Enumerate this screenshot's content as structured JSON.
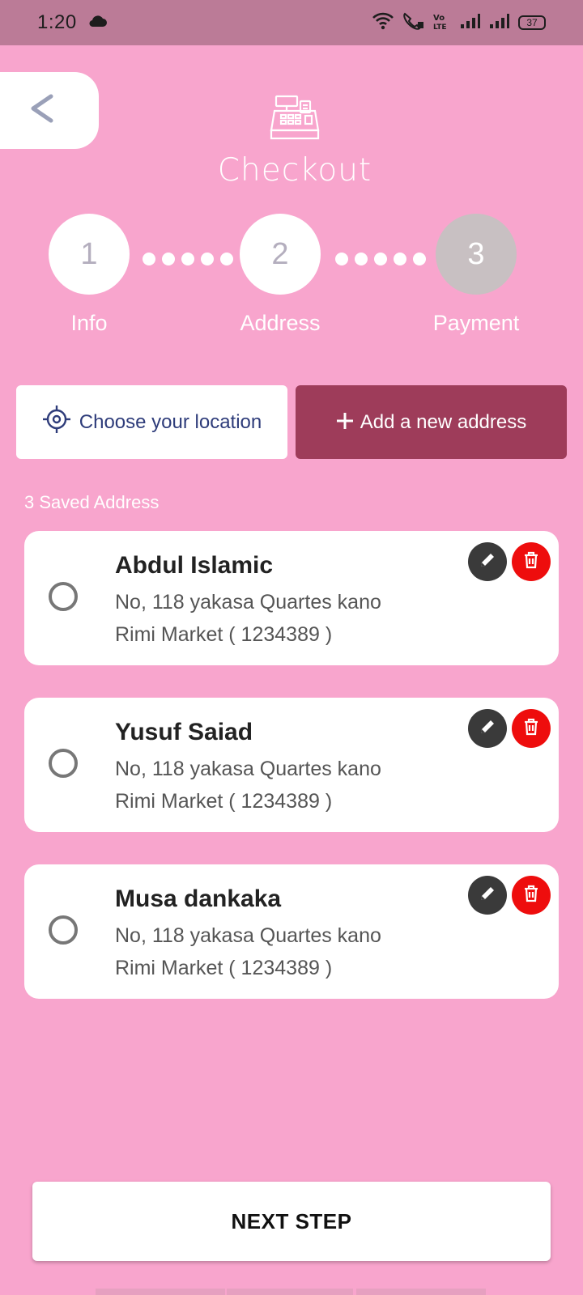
{
  "status_bar": {
    "time": "1:20",
    "battery": "37"
  },
  "header": {
    "title": "Checkout"
  },
  "stepper": {
    "steps": [
      {
        "number": "1",
        "label": "Info"
      },
      {
        "number": "2",
        "label": "Address"
      },
      {
        "number": "3",
        "label": "Payment"
      }
    ]
  },
  "actions": {
    "choose_location": "Choose your location",
    "add_address": "Add a new address"
  },
  "saved": {
    "count_label": "3 Saved Address",
    "addresses": [
      {
        "name": "Abdul Islamic",
        "line1": "No, 118 yakasa Quartes kano",
        "line2": "Rimi Market ( 1234389 )"
      },
      {
        "name": "Yusuf Saiad",
        "line1": "No, 118 yakasa Quartes kano",
        "line2": "Rimi Market ( 1234389 )"
      },
      {
        "name": "Musa dankaka",
        "line1": "No, 118 yakasa Quartes kano",
        "line2": "Rimi Market ( 1234389 )"
      }
    ]
  },
  "footer": {
    "next_label": "NEXT STEP"
  },
  "colors": {
    "background": "#f8a5cd",
    "status_bar": "#bb7b97",
    "accent": "#9e3c5a",
    "delete": "#ee0d0d",
    "edit": "#3a3a3a",
    "step_inactive": "#c8c0c2"
  }
}
